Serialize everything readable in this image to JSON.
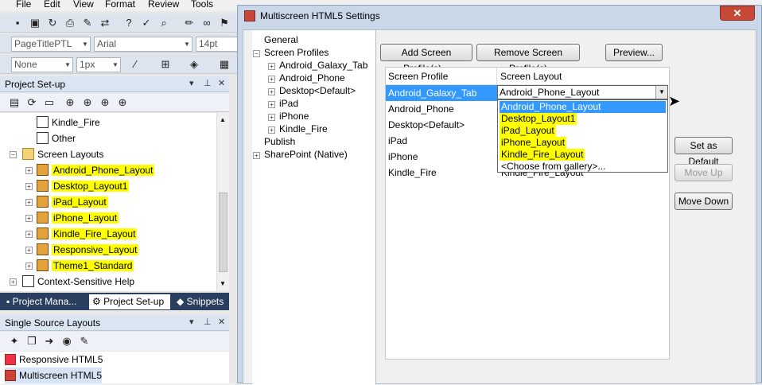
{
  "menu": [
    "File",
    "Edit",
    "View",
    "Format",
    "Review",
    "Tools",
    "Window",
    "Help"
  ],
  "toolbar": {
    "style_combo": "PageTitlePTL",
    "font_combo": "Arial",
    "size_combo": "14pt",
    "border_style_combo": "None",
    "border_width_combo": "1px"
  },
  "project_setup": {
    "title": "Project Set-up",
    "items": [
      {
        "label": "Kindle_Fire",
        "highlight": false
      },
      {
        "label": "Other",
        "highlight": false
      }
    ],
    "screen_layouts_label": "Screen Layouts",
    "layouts": [
      "Android_Phone_Layout",
      "Desktop_Layout1",
      "iPad_Layout",
      "iPhone_Layout",
      "Kindle_Fire_Layout",
      "Responsive_Layout",
      "Theme1_Standard"
    ],
    "context_help": "Context-Sensitive Help"
  },
  "tabs": [
    "Project Mana...",
    "Project Set-up",
    "Snippets"
  ],
  "single_source": {
    "title": "Single Source Layouts",
    "items": [
      "Responsive HTML5",
      "Multiscreen HTML5"
    ]
  },
  "dialog": {
    "title": "Multiscreen HTML5 Settings",
    "tree": {
      "general": "General",
      "screen_profiles": "Screen Profiles",
      "profiles": [
        "Android_Galaxy_Tab",
        "Android_Phone",
        "Desktop<Default>",
        "iPad",
        "iPhone",
        "Kindle_Fire"
      ],
      "publish": "Publish",
      "sharepoint": "SharePoint (Native)"
    },
    "buttons": {
      "add": "Add Screen Profile(s)...",
      "remove": "Remove Screen Profile(s)",
      "preview": "Preview...",
      "set_default": "Set as Default",
      "move_up": "Move Up",
      "move_down": "Move Down"
    },
    "grid": {
      "headers": [
        "Screen Profile",
        "Screen Layout"
      ],
      "rows": [
        {
          "profile": "Android_Galaxy_Tab",
          "layout": "Android_Phone_Layout"
        },
        {
          "profile": "Android_Phone",
          "layout": ""
        },
        {
          "profile": "Desktop<Default>",
          "layout": ""
        },
        {
          "profile": "iPad",
          "layout": ""
        },
        {
          "profile": "iPhone",
          "layout": ""
        },
        {
          "profile": "Kindle_Fire",
          "layout": "Kindle_Fire_Layout"
        }
      ]
    },
    "dropdown_options": [
      "Android_Phone_Layout",
      "Desktop_Layout1",
      "iPad_Layout",
      "iPhone_Layout",
      "Kindle_Fire_Layout",
      "<Choose from gallery>..."
    ]
  }
}
